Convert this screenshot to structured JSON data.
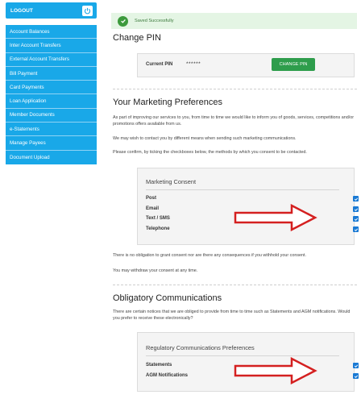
{
  "sidebar": {
    "logout_label": "LOGOUT",
    "items": [
      {
        "label": "Account Balances"
      },
      {
        "label": "Inter Account Transfers"
      },
      {
        "label": "External Account Transfers"
      },
      {
        "label": "Bill Payment"
      },
      {
        "label": "Card Payments"
      },
      {
        "label": "Loan Application"
      },
      {
        "label": "Member Documents"
      },
      {
        "label": "e-Statements"
      },
      {
        "label": "Manage Payees"
      },
      {
        "label": "Document Upload"
      }
    ]
  },
  "alert": {
    "message": "Saved Successfully"
  },
  "change_pin": {
    "title": "Change PIN",
    "current_pin_label": "Current PIN",
    "current_pin_value": "******",
    "button_label": "CHANGE PIN"
  },
  "marketing": {
    "title": "Your Marketing Preferences",
    "para1": "As part of improving our services to you, from time to time we would like to inform you of goods, services, competitions and/or promotions offers available from us.",
    "para2": "We may wish to contact you by different means when sending such marketing communications.",
    "para3": "Please confirm, by ticking the checkboxes below, the methods by which you consent to be contacted.",
    "consent_title": "Marketing Consent",
    "options": [
      {
        "label": "Post",
        "checked": true
      },
      {
        "label": "Email",
        "checked": true
      },
      {
        "label": "Text / SMS",
        "checked": true
      },
      {
        "label": "Telephone",
        "checked": true
      }
    ],
    "note1": "There is no obligation to grant consent nor are there any consequences if you withhold your consent.",
    "note2": "You may withdraw your consent at any time."
  },
  "obligatory": {
    "title": "Obligatory Communications",
    "para": "There are certain notices that we are obliged to provide from time to time such as Statements and AGM notifications. Would you prefer to receive these electronically?",
    "pref_title": "Regulatory Communications Preferences",
    "options": [
      {
        "label": "Statements",
        "checked": true
      },
      {
        "label": "AGM Notifications",
        "checked": true
      }
    ]
  },
  "colors": {
    "sidebar": "#19a8e8",
    "checkbox": "#1a7ad4",
    "button": "#2e9d4c",
    "arrow": "#d42020"
  }
}
